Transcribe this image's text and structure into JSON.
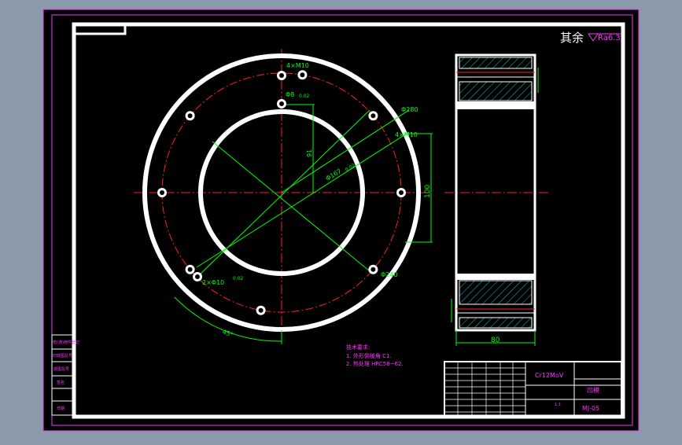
{
  "surface_note": {
    "text": "其余",
    "roughness": "Ra6.3"
  },
  "dimensions": {
    "holes_top": "4×M10",
    "pin_hole": "Φ8",
    "pin_hole_tol": "0.02",
    "outer_diameter": "Φ280",
    "holes_right": "4×M10",
    "pcd_small": "Φ167",
    "pcd_small_tol": "0.02",
    "radius_label": "91",
    "height_100": "100",
    "pins_bottom": "2×Φ10",
    "pins_bottom_tol": "0.02",
    "pcd_240": "Φ240",
    "angle": "45°",
    "width_80": "80"
  },
  "tech_requirements": {
    "title": "技术要求:",
    "line1": "1. 外形倒棱角 C1.",
    "line2": "2. 热处理 HRC58~62."
  },
  "title_block": {
    "material": "Cr12MoV",
    "part_name": "凹模",
    "drawing_no": "MJ-05",
    "scale": "1:1"
  },
  "left_strip": {
    "items": [
      "借(通)用件登记",
      "旧底图总号",
      "底图总号",
      "签名",
      "日期"
    ]
  },
  "colors": {
    "background": "#000000",
    "frame": "#ffffff",
    "center_lines": "#ff2020",
    "dimension_lines": "#00ff00",
    "text_magenta": "#ff33ff",
    "hatch": "#00c8c8"
  }
}
